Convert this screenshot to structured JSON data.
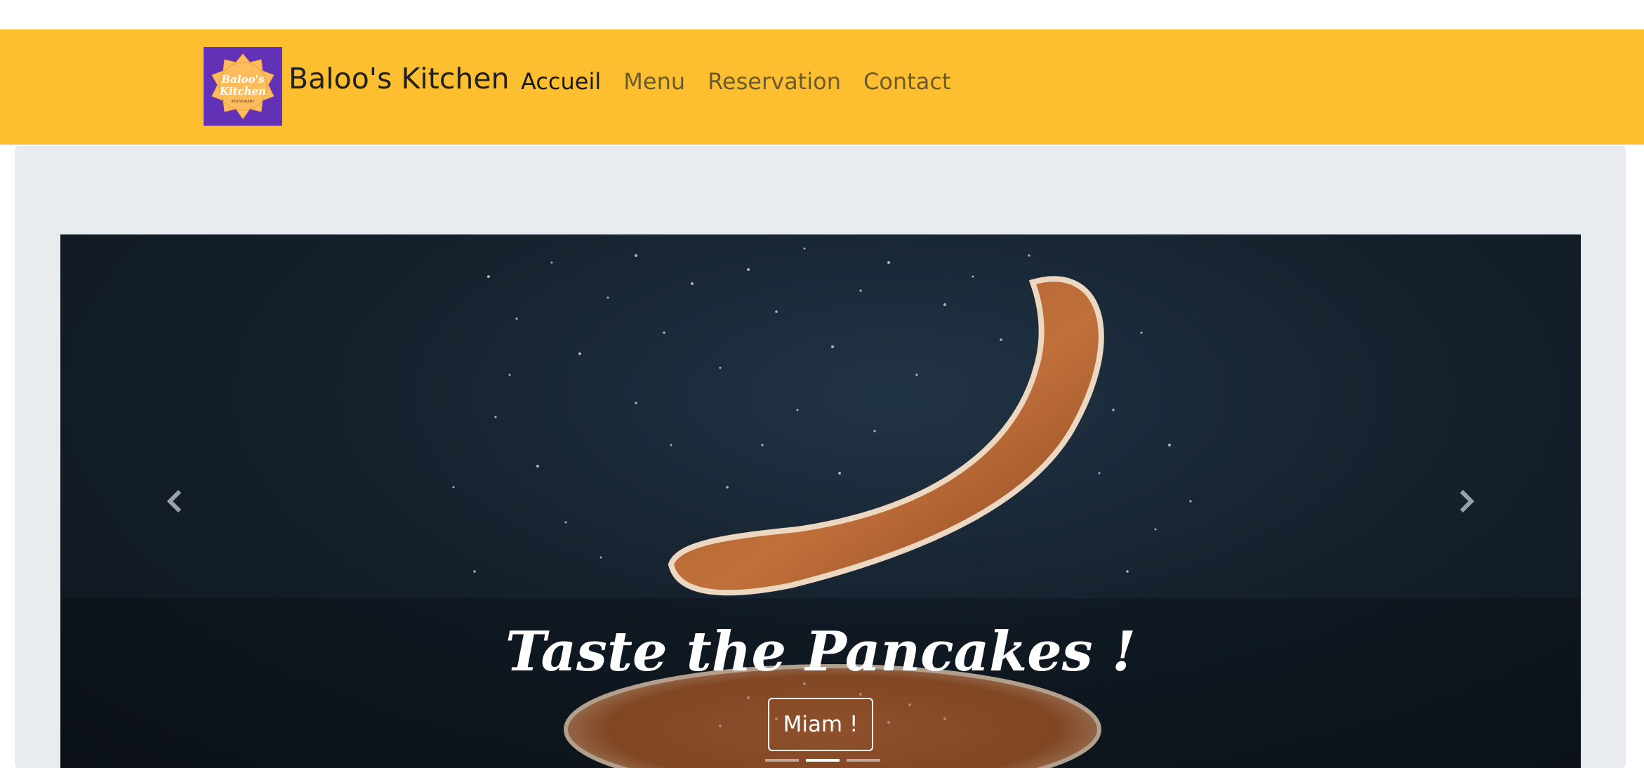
{
  "brand": {
    "name": "Baloo's Kitchen",
    "logo_text_line1": "Baloo's",
    "logo_text_line2": "Kitchen",
    "logo_subtext": "RESTAURANT"
  },
  "nav": {
    "items": [
      {
        "label": "Accueil",
        "active": true
      },
      {
        "label": "Menu",
        "active": false
      },
      {
        "label": "Reservation",
        "active": false
      },
      {
        "label": "Contact",
        "active": false
      }
    ]
  },
  "carousel": {
    "title": "Taste the Pancakes !",
    "button_label": "Miam !",
    "slide_count": 3,
    "active_slide": 2,
    "prev_icon": "chevron-left-icon",
    "next_icon": "chevron-right-icon"
  },
  "colors": {
    "navbar_bg": "#fdbf30",
    "logo_bg": "#6231b5",
    "jumbotron_bg": "#e9ecef",
    "nav_active": "#1a1a1a",
    "nav_inactive": "#6b5a2c"
  }
}
